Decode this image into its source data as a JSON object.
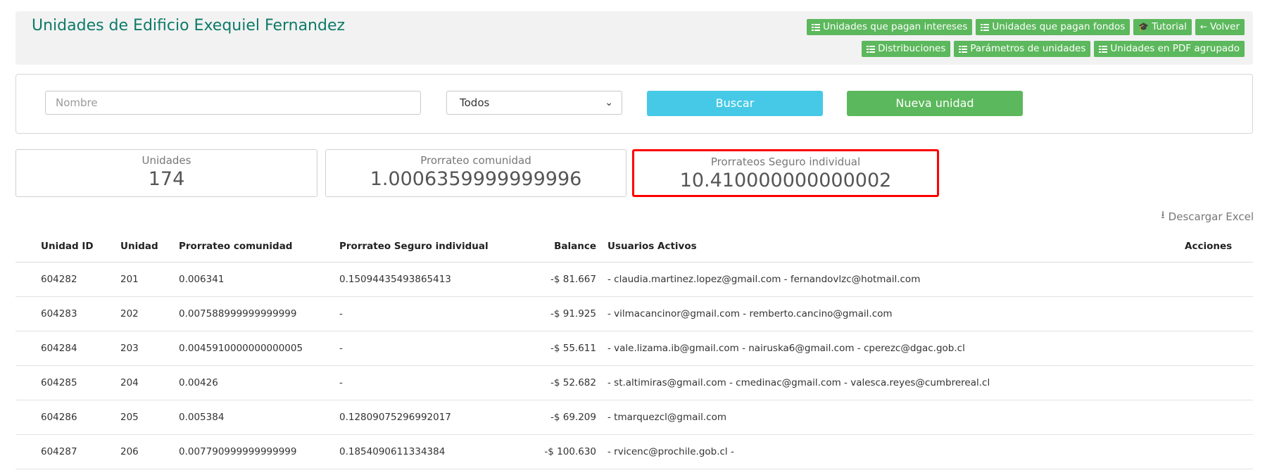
{
  "header": {
    "title": "Unidades de Edificio Exequiel Fernandez",
    "buttons_row1": [
      {
        "label": "Unidades que pagan intereses",
        "icon": "list-icon"
      },
      {
        "label": "Unidades que pagan fondos",
        "icon": "list-icon"
      },
      {
        "label": "Tutorial",
        "icon": "graduation-cap-icon"
      },
      {
        "label": "Volver",
        "icon": "arrow-left-icon"
      }
    ],
    "buttons_row2": [
      {
        "label": "Distribuciones",
        "icon": "list-icon"
      },
      {
        "label": "Parámetros de unidades",
        "icon": "list-icon"
      },
      {
        "label": "Unidades en PDF agrupado",
        "icon": "list-icon"
      }
    ]
  },
  "filters": {
    "name_placeholder": "Nombre",
    "select_value": "Todos",
    "search_label": "Buscar",
    "new_label": "Nueva unidad"
  },
  "stats": [
    {
      "label": "Unidades",
      "value": "174"
    },
    {
      "label": "Prorrateo comunidad",
      "value": "1.0006359999999996"
    },
    {
      "label": "Prorrateos Seguro individual",
      "value": "10.410000000000002"
    }
  ],
  "excel_label": "Descargar Excel",
  "table": {
    "headers": [
      "Unidad ID",
      "Unidad",
      "Prorrateo comunidad",
      "Prorrateo Seguro individual",
      "Balance",
      "Usuarios Activos",
      "Acciones"
    ],
    "rows": [
      [
        "604282",
        "201",
        "0.006341",
        "0.15094435493865413",
        "-$ 81.667",
        "- claudia.martinez.lopez@gmail.com - fernandovlzc@hotmail.com",
        ""
      ],
      [
        "604283",
        "202",
        "0.007588999999999999",
        "-",
        "-$ 91.925",
        "- vilmacancinor@gmail.com - remberto.cancino@gmail.com",
        ""
      ],
      [
        "604284",
        "203",
        "0.0045910000000000005",
        "-",
        "-$ 55.611",
        "- vale.lizama.ib@gmail.com - nairuska6@gmail.com - cperezc@dgac.gob.cl",
        ""
      ],
      [
        "604285",
        "204",
        "0.00426",
        "-",
        "-$ 52.682",
        "- st.altimiras@gmail.com - cmedinac@gmail.com - valesca.reyes@cumbrereal.cl",
        ""
      ],
      [
        "604286",
        "205",
        "0.005384",
        "0.12809075296992017",
        "-$ 69.209",
        "- tmarquezcl@gmail.com",
        ""
      ],
      [
        "604287",
        "206",
        "0.007790999999999999",
        "0.1854090611334384",
        "-$ 100.630",
        "- rvicenc@prochile.gob.cl -",
        ""
      ]
    ]
  }
}
